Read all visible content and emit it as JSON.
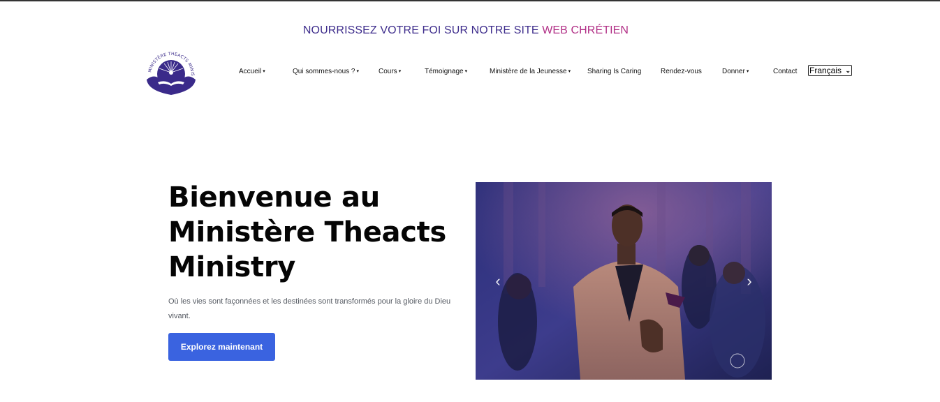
{
  "tagline": {
    "part1": "NOURRISSEZ VOTRE FOI SUR NOTRE SITE",
    "part2": "WEB CHRÉTIEN"
  },
  "logo": {
    "alt": "Ministère Theacts Ministry logo",
    "ring_text": "MINISTÈRE THEACTS MINISTRY",
    "colors": {
      "primary": "#3a2a8a"
    }
  },
  "nav": {
    "items": [
      {
        "label": "Accueil",
        "caret": "▾"
      },
      {
        "label": "Qui sommes-nous ?",
        "caret": "▾"
      },
      {
        "label": "Cours",
        "caret": "▾"
      },
      {
        "label": "Témoignage",
        "caret": "▾"
      },
      {
        "label": "Ministère de la Jeunesse",
        "caret": "▾"
      },
      {
        "label": "Sharing Is Caring",
        "caret": ""
      },
      {
        "label": "Rendez-vous",
        "caret": ""
      },
      {
        "label": "Donner",
        "caret": "▾"
      },
      {
        "label": "Contact",
        "caret": ""
      }
    ]
  },
  "language": {
    "selected": "Français"
  },
  "hero": {
    "title": "Bienvenue au Ministère Theacts Ministry",
    "subtitle": "Où les vies sont façonnées et les destinées sont transformés pour la gloire du Dieu vivant.",
    "cta_label": "Explorez maintenant"
  },
  "carousel": {
    "prev_icon": "chevron-left-icon",
    "next_icon": "chevron-right-icon"
  },
  "colors": {
    "accent": "#3a63e0",
    "tagline_primary": "#3e2d8c",
    "tagline_secondary": "#b12f86"
  }
}
